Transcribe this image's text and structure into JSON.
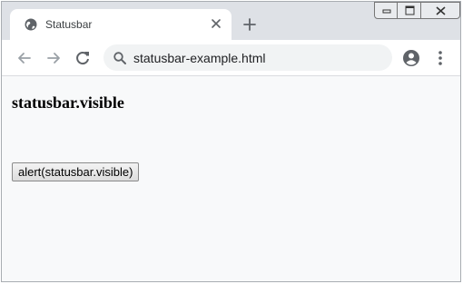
{
  "tab": {
    "title": "Statusbar",
    "favicon_icon": "globe-icon",
    "close_icon": "close-icon"
  },
  "new_tab_icon": "plus-icon",
  "window_controls": [
    "minimize-icon",
    "maximize-icon",
    "close-icon"
  ],
  "toolbar": {
    "back_icon": "arrow-left-icon",
    "forward_icon": "arrow-right-icon",
    "reload_icon": "reload-icon",
    "profile_icon": "account-icon",
    "menu_icon": "more-vertical-icon"
  },
  "omnibox": {
    "search_icon": "search-icon",
    "url": "statusbar-example.html"
  },
  "page": {
    "heading": "statusbar.visible",
    "button_label": "alert(statusbar.visible)"
  },
  "colors": {
    "titlebar": "#dee1e6",
    "toolbar": "#ffffff",
    "omnibox": "#f1f3f4",
    "content_bg": "#f8f9fa",
    "icon": "#5f6368"
  }
}
